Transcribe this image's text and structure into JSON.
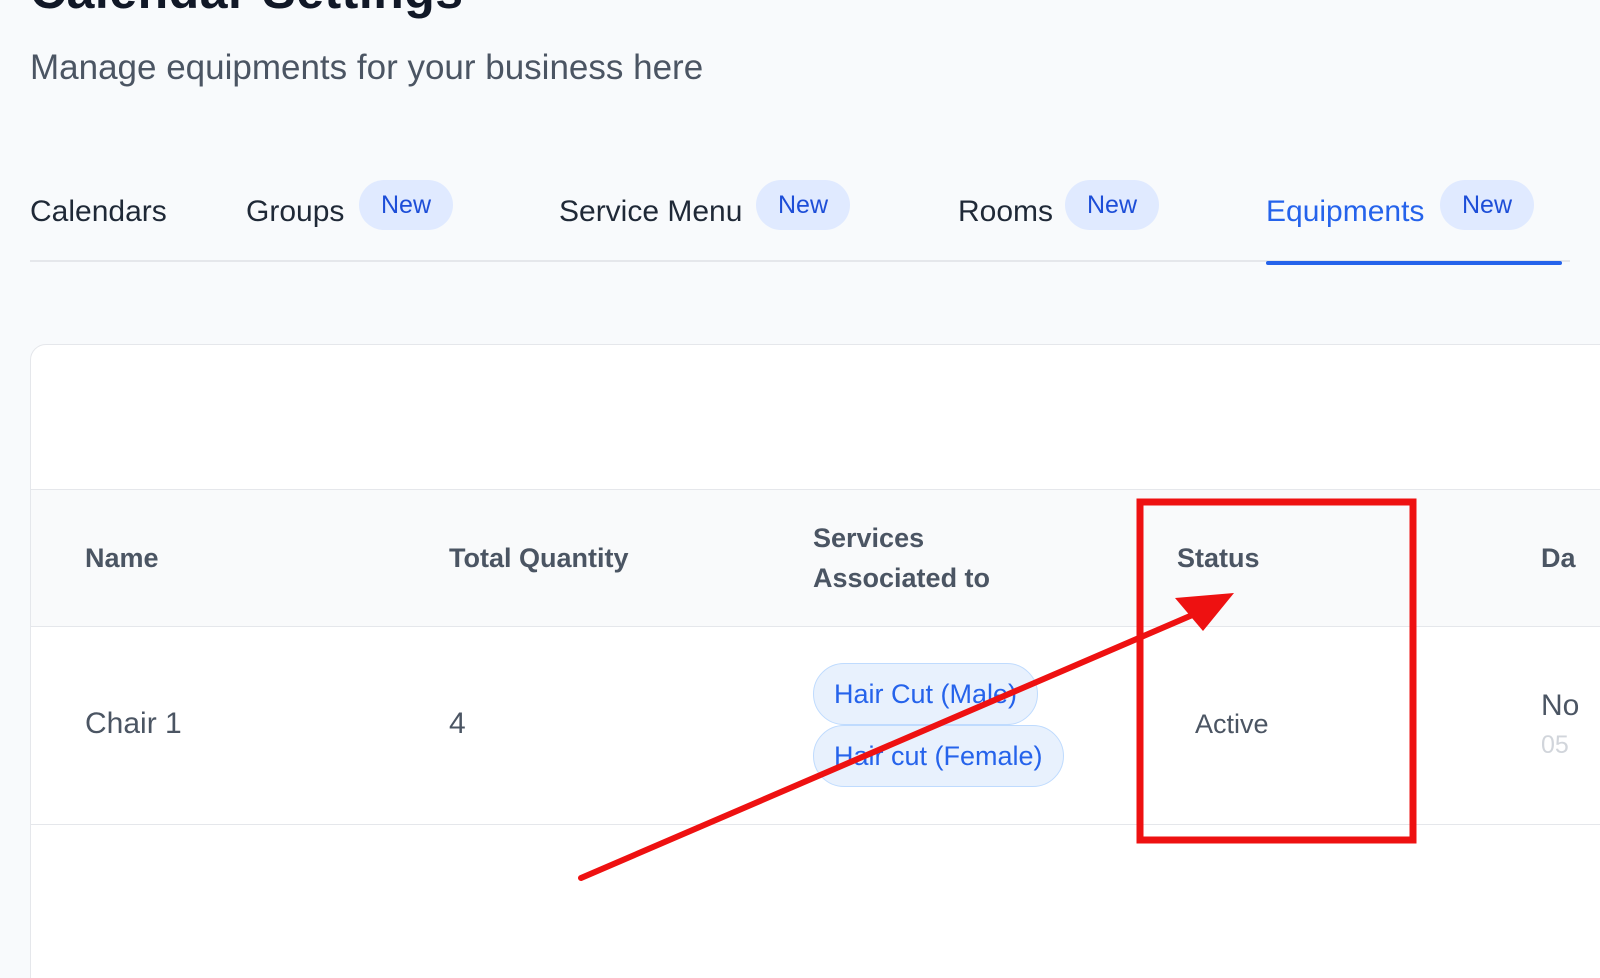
{
  "header": {
    "title": "Calendar Settings",
    "subtitle": "Manage equipments for your business here"
  },
  "tabs": [
    {
      "label": "Calendars",
      "badge": "",
      "active": false
    },
    {
      "label": "Groups",
      "badge": "New",
      "active": false
    },
    {
      "label": "Service Menu",
      "badge": "New",
      "active": false
    },
    {
      "label": "Rooms",
      "badge": "New",
      "active": false
    },
    {
      "label": "Equipments",
      "badge": "New",
      "active": true
    }
  ],
  "table": {
    "columns": [
      "Name",
      "Total Quantity",
      "Services",
      "Associated to",
      "Status",
      "Da"
    ],
    "rows": [
      {
        "name": "Chair 1",
        "total_quantity": "4",
        "services": [
          "Hair Cut (Male)",
          "Hair cut (Female)"
        ],
        "status": "Active",
        "date_partial": "No",
        "date_sub_partial": "05"
      }
    ]
  },
  "colors": {
    "accent": "#2563eb",
    "badge_bg": "#e0eaff",
    "annotation": "#ee1111"
  }
}
